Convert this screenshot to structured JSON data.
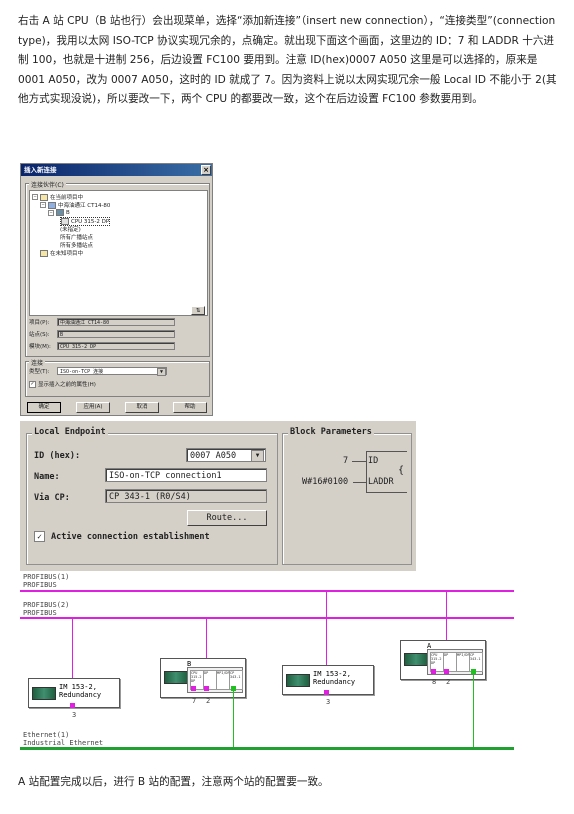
{
  "intro_text": "右击 A 站 CPU（B 站也行）会出现菜单，选择“添加新连接”（insert new connection），“连接类型”(connection type)，我用以太网 ISO-TCP 协议实现冗余的，点确定。就出现下面这个画面，这里边的 ID：7 和 LADDR 十六进制 100，也就是十进制 256，后边设置 FC100 要用到。注意 ID(hex)0007 A050 这里是可以选择的，原来是 0001 A050，改为 0007 A050，这时的 ID 就成了 7。因为资料上说以太网实现冗余一般 Local ID 不能小于 2(其他方式实现没说)，所以要改一下，两个 CPU 的都要改一致，这个在后边设置 FC100 参数要用到。",
  "dialog": {
    "title": "插入新连接",
    "close": "×",
    "partner_group": "连接伙伴(C)",
    "tree": [
      {
        "label": "在当前项目中",
        "level": 0
      },
      {
        "label": "中海油通江 CT14-80",
        "level": 1
      },
      {
        "label": "B",
        "level": 2
      },
      {
        "label": "CPU 315-2 DP",
        "level": 3
      },
      {
        "label": "(未指定)",
        "level": 2
      },
      {
        "label": "所有广播站点",
        "level": 2
      },
      {
        "label": "所有多播站点",
        "level": 2
      },
      {
        "label": "在未知项目中",
        "level": 0
      }
    ],
    "project_label": "项目(P):",
    "project_value": "中海油通江 CT14-80",
    "station_label": "站点(S):",
    "station_value": "B",
    "module_label": "模块(M):",
    "module_value": "CPU 315-2 DP",
    "conn_group": "连接",
    "type_label": "类型(T):",
    "type_value": "ISO-on-TCP 连接",
    "show_props": "显示插入之前的属性(H)",
    "ok": "确定",
    "apply": "应用(A)",
    "cancel": "取消",
    "help": "帮助"
  },
  "endpoint": {
    "local_title": "Local Endpoint",
    "id_label": "ID (hex):",
    "id_value": "0007 A050",
    "name_label": "Name:",
    "name_value": "ISO-on-TCP connection1",
    "via_label": "Via CP:",
    "via_value": "CP 343-1 (R0/S4)",
    "route": "Route...",
    "active": "Active connection establishment",
    "block_title": "Block Parameters",
    "id_num": "7",
    "id_pin": "ID",
    "laddr_val": "W#16#0100",
    "laddr_pin": "LADDR"
  },
  "network": {
    "profibus1": [
      "PROFIBUS(1)",
      "PROFIBUS"
    ],
    "profibus2": [
      "PROFIBUS(2)",
      "PROFIBUS"
    ],
    "ethernet": [
      "Ethernet(1)",
      "Industrial Ethernet"
    ],
    "im1": [
      "IM 153-2,",
      "Redundancy"
    ],
    "im1_num": "3",
    "im2": [
      "IM 153-2,",
      "Redundancy"
    ],
    "im2_num": "3",
    "stationB": "B",
    "stationB_nums": [
      "7",
      "2"
    ],
    "stationA": "A",
    "stationA_nums": [
      "8",
      "2"
    ],
    "slot_labels": [
      "CPU 315-2 DP",
      "DP",
      "MPI/DP",
      "CP 343-1"
    ]
  },
  "outro_text": "A 站配置完成以后，进行 B 站的配置，注意两个站的配置要一致。",
  "colors": {
    "profibus": "#e020e0",
    "ethernet": "#20a030",
    "titlebar": "#0a246a"
  }
}
